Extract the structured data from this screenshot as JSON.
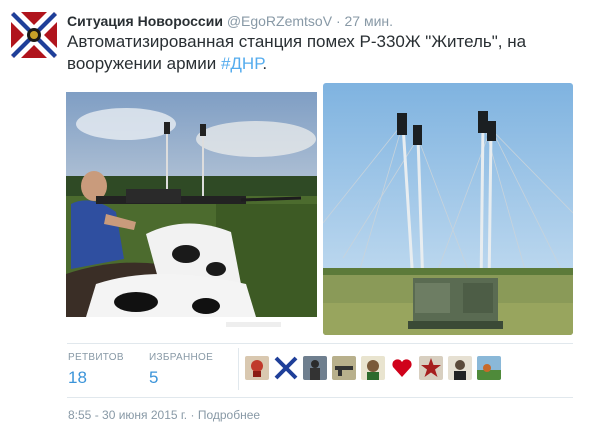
{
  "author": {
    "name": "Ситуация Новороссии",
    "handle": "@EgoRZemtsoV",
    "separator": "·",
    "time": "27 мин."
  },
  "tweet": {
    "text": "Автоматизированная станция помех Р-330Ж \"Житель\", на вооружении армии ",
    "hashtag": "#ДНР",
    "trailing": "."
  },
  "stats": {
    "retweets_label": "РЕТВИТОВ",
    "retweets_value": "18",
    "favorites_label": "ИЗБРАННОЕ",
    "favorites_value": "5"
  },
  "footer": {
    "timestamp": "8:55 - 30 июня 2015 г.",
    "separator": "·",
    "details": "Подробнее"
  },
  "colors": {
    "link": "#55acee",
    "count": "#3b94d9",
    "muted": "#8899a6"
  },
  "icons": {
    "avatar": "novorossiya-flag-avatar",
    "retweeter_avatars": [
      "skull-avatar",
      "x-flag-avatar",
      "soldier-avatar",
      "gun-avatar",
      "cartoon-avatar",
      "heart-avatar",
      "star-avatar",
      "portrait-avatar",
      "landscape-avatar"
    ]
  }
}
